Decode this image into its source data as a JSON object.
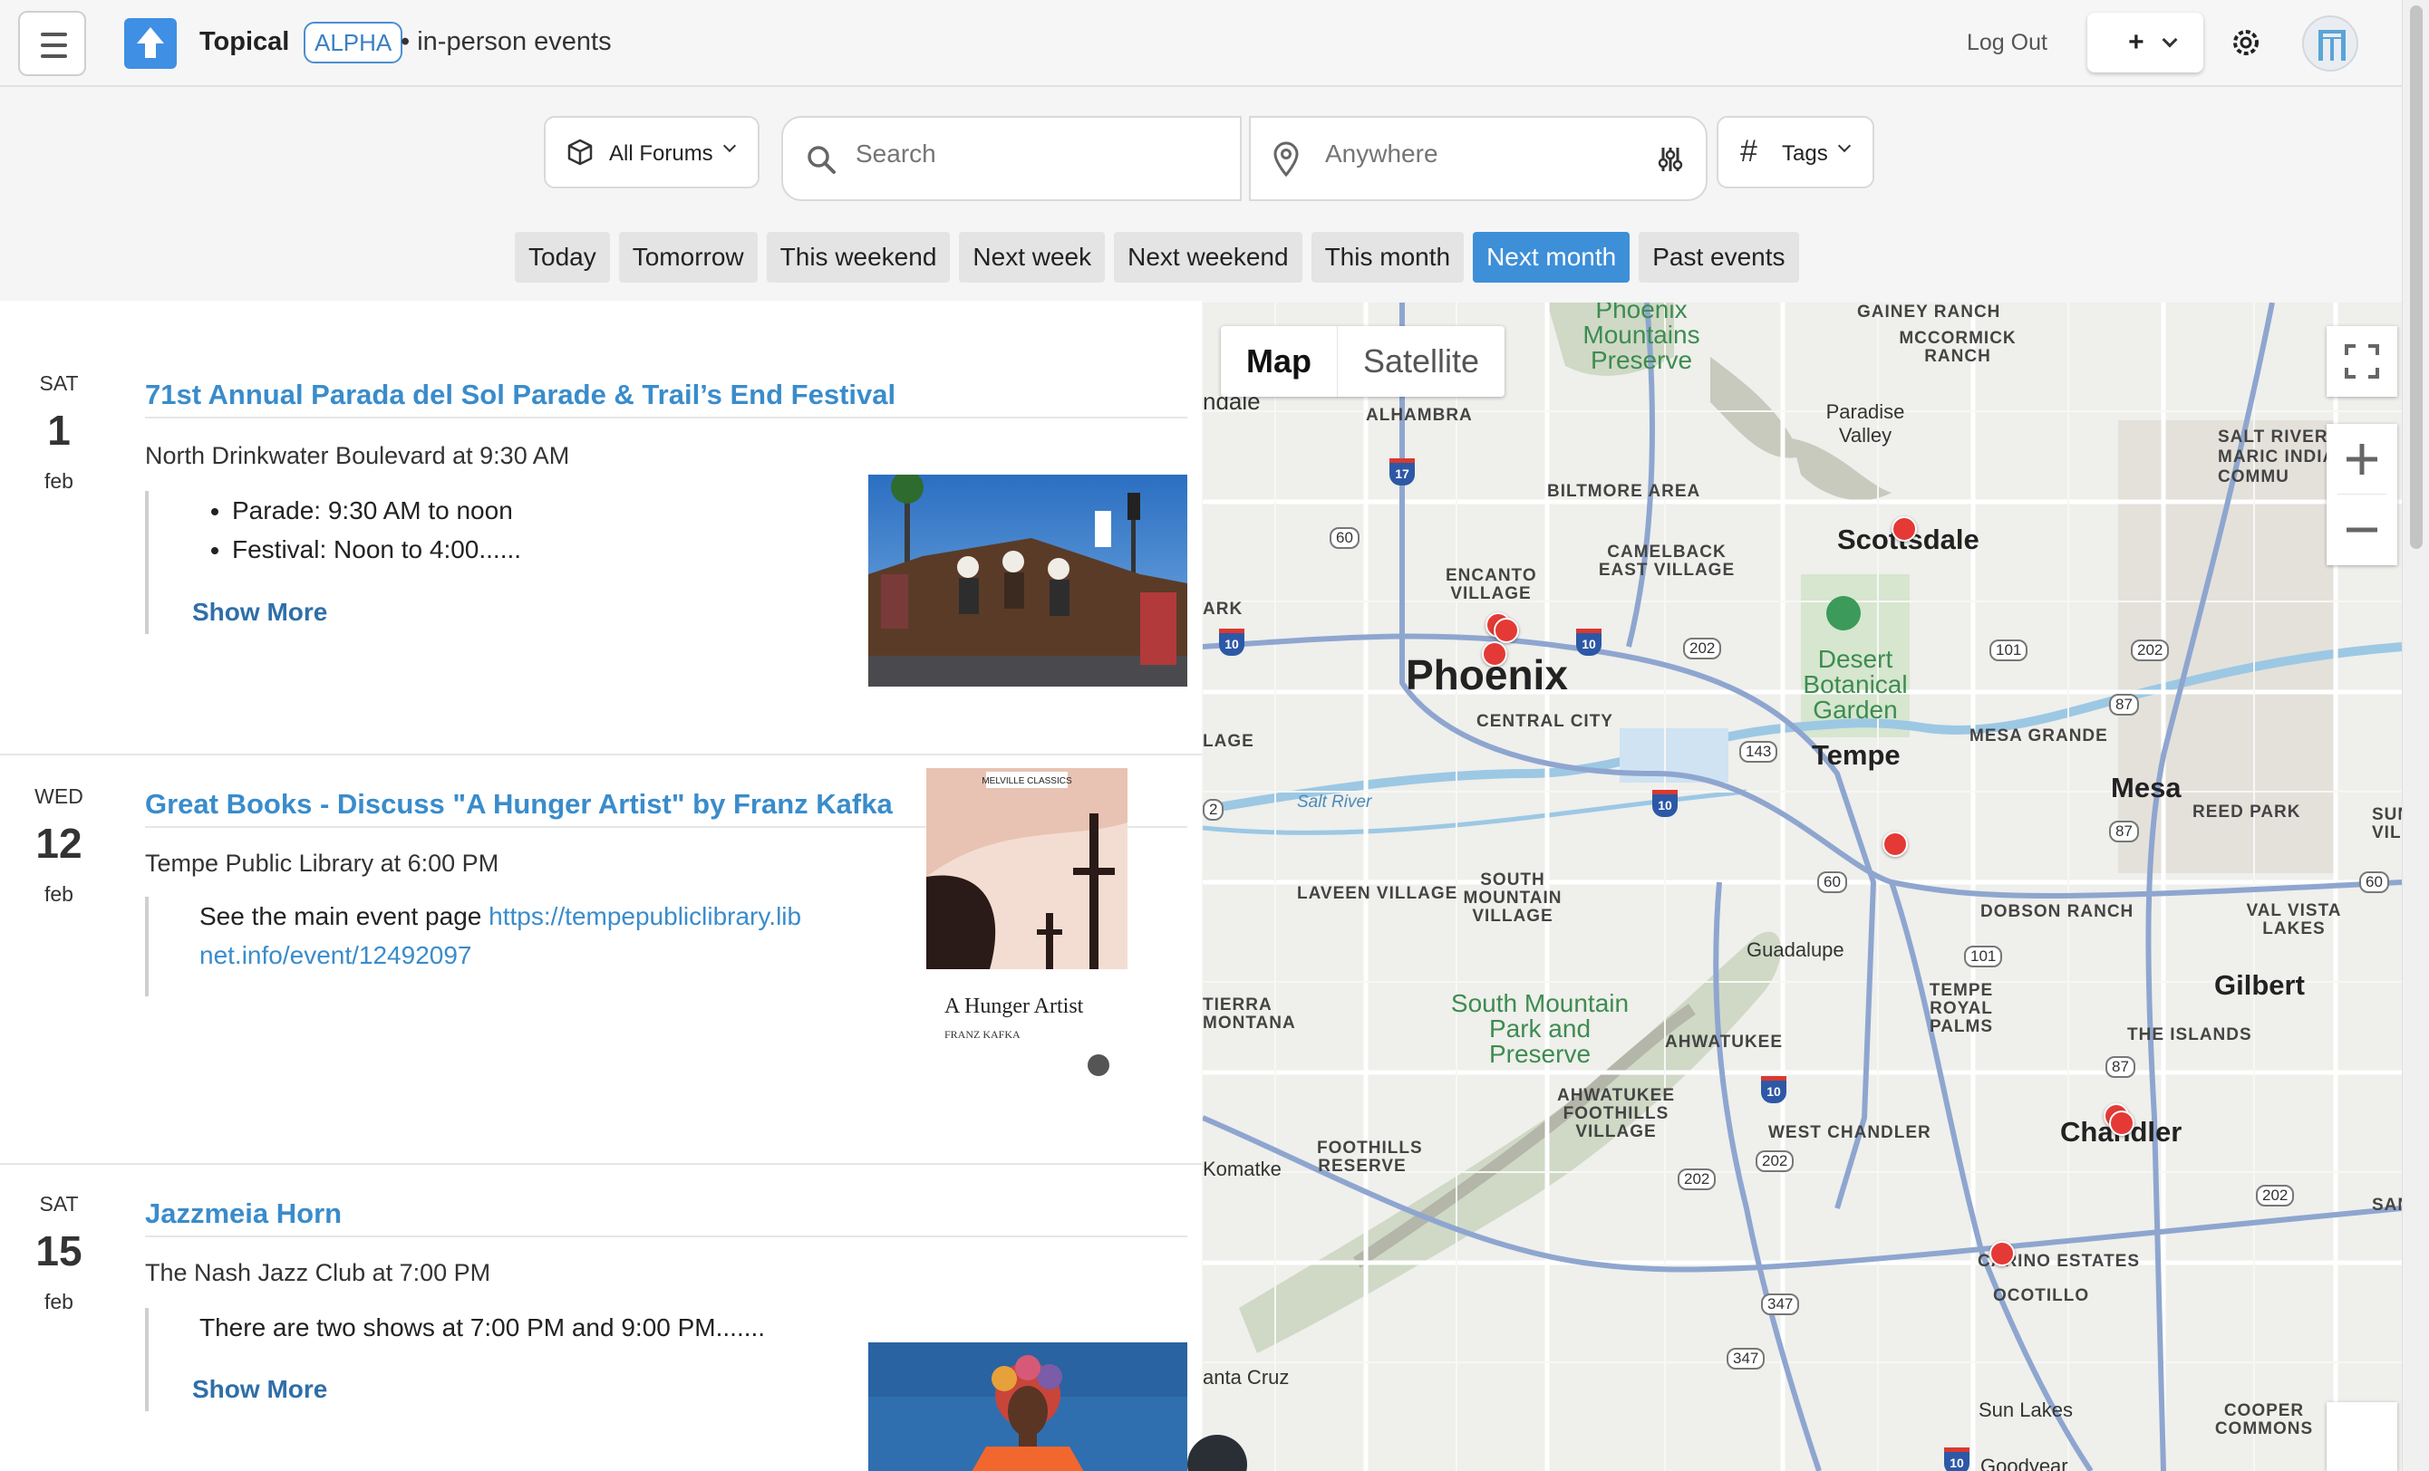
{
  "header": {
    "brand": "Topical",
    "badge": "ALPHA",
    "subtitle": "• in-person events",
    "logout": "Log Out",
    "add_button": "+"
  },
  "filters": {
    "forums_label": "All Forums",
    "search_placeholder": "Search",
    "location_placeholder": "Anywhere",
    "tags_label": "Tags"
  },
  "date_chips": [
    {
      "label": "Today",
      "active": false
    },
    {
      "label": "Tomorrow",
      "active": false
    },
    {
      "label": "This weekend",
      "active": false
    },
    {
      "label": "Next week",
      "active": false
    },
    {
      "label": "Next weekend",
      "active": false
    },
    {
      "label": "This month",
      "active": false
    },
    {
      "label": "Next month",
      "active": true
    },
    {
      "label": "Past events",
      "active": false
    }
  ],
  "events": [
    {
      "dow": "SAT",
      "day": "1",
      "month": "feb",
      "title": "71st Annual Parada del Sol Parade & Trail’s End Festival",
      "location": "North Drinkwater Boulevard at 9:30 AM",
      "bullets": [
        "Parade: 9:30 AM to noon",
        "Festival: Noon to 4:00......"
      ],
      "show_more": "Show More"
    },
    {
      "dow": "WED",
      "day": "12",
      "month": "feb",
      "title": "Great Books - Discuss \"A Hunger Artist\" by Franz Kafka",
      "location": "Tempe Public Library at 6:00 PM",
      "text_prefix": "See the main event page ",
      "link_line1": "https://tempepubliclibrary.lib",
      "link_line2": "net.info/event/12492097",
      "book_series": "MELVILLE CLASSICS",
      "book_title": "A Hunger Artist",
      "book_author": "FRANZ KAFKA"
    },
    {
      "dow": "SAT",
      "day": "15",
      "month": "feb",
      "title": "Jazzmeia Horn",
      "location": "The Nash Jazz Club at 7:00 PM",
      "text": "There are two shows at 7:00 PM and 9:00 PM.......",
      "show_more": "Show More"
    }
  ],
  "map": {
    "type_map": "Map",
    "type_satellite": "Satellite",
    "labels": {
      "phoenix": "Phoenix",
      "central_city": "CENTRAL CITY",
      "tempe": "Tempe",
      "mesa": "Mesa",
      "scottsdale": "Scottsdale",
      "gilbert": "Gilbert",
      "chandler": "Chandler",
      "guadalupe": "Guadalupe",
      "paradise_valley": "Paradise Valley",
      "alhambra": "ALHAMBRA",
      "biltmore": "BILTMORE AREA",
      "camelback": "CAMELBACK EAST VILLAGE",
      "encanto": "ENCANTO VILLAGE",
      "gainey": "GAINEY RANCH",
      "mccormick": "MCCORMICK RANCH",
      "salt_river": "SALT RIVER -MARIC INDIA COMMU",
      "mesa_grande": "MESA GRANDE",
      "reed_park": "REED PARK",
      "laveen": "LAVEEN VILLAGE",
      "south_mountain_village": "SOUTH MOUNTAIN VILLAGE",
      "dobson": "DOBSON RANCH",
      "val_vista": "VAL VISTA LAKES",
      "tempe_royal": "TEMPE ROYAL PALMS",
      "the_islands": "THE ISLANDS",
      "ahwatukee": "AHWATUKEE",
      "ahwatukee_foothills": "AHWATUKEE FOOTHILLS VILLAGE",
      "foothills_reserve": "FOOTHILLS RESERVE",
      "west_chandler": "WEST CHANDLER",
      "carino": "CARINO ESTATES",
      "ocotillo": "OCOTILLO",
      "sun_lakes": "Sun Lakes",
      "cooper": "COOPER COMMONS",
      "komatke": "Komatke",
      "santa_cruz": "anta Cruz",
      "tierra": "TIERRA MONTANA",
      "south_mountain_park": "South Mountain Park and Preserve",
      "desert_botanical": "Desert Botanical Garden",
      "phoenix_mountains": "Phoenix Mountains Preserve",
      "salt_river_water": "Salt River",
      "glendale": "ndale",
      "ark": "ARK",
      "lage": "LAGE",
      "goodyear": "Goodyear",
      "sun": "SUN VIL",
      "sa": "SAN"
    }
  },
  "colors": {
    "accent": "#3d8fd8",
    "title_link": "#3a8ccb",
    "pin": "#e53935",
    "badge_border": "#4a8fd0"
  }
}
